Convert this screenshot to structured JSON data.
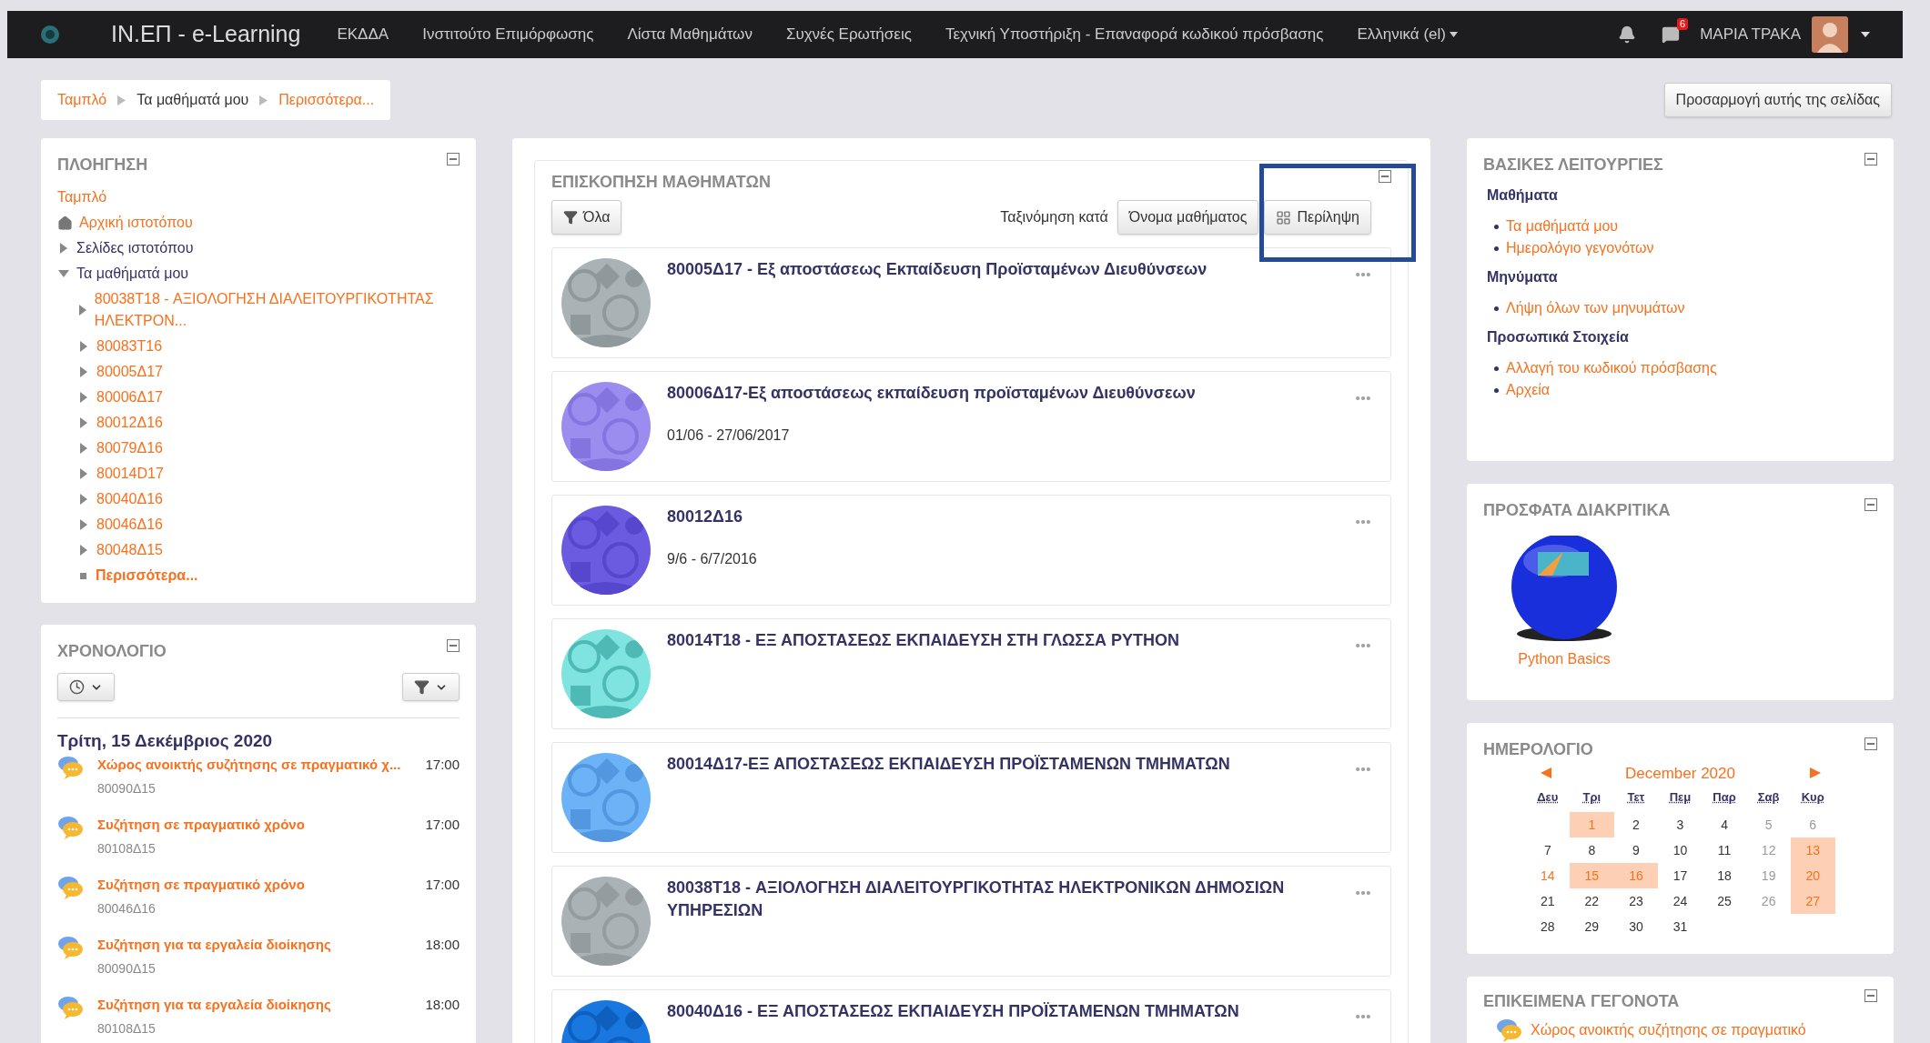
{
  "navbar": {
    "site_name": "ΙΝ.ΕΠ - e-Learning",
    "menu": [
      "ΕΚΔΔΑ",
      "Ινστιτούτο Επιμόρφωσης",
      "Λίστα Μαθημάτων",
      "Συχνές Ερωτήσεις",
      "Τεχνική Υποστήριξη - Επαναφορά κωδικού πρόσβασης"
    ],
    "language": "Ελληνικά (el)",
    "message_count": "6",
    "user_name": "ΜΑΡΙΑ ΤΡΑΚΑ"
  },
  "breadcrumb": [
    {
      "label": "Ταμπλό",
      "kind": "link"
    },
    {
      "label": "Τα μαθήματά μου",
      "kind": "current"
    },
    {
      "label": "Περισσότερα...",
      "kind": "link"
    }
  ],
  "customize_button": "Προσαρμογή αυτής της σελίδας",
  "navigation": {
    "title": "ΠΛΟΗΓΗΣΗ",
    "items": [
      {
        "kind": "link",
        "label": "Ταμπλό"
      },
      {
        "kind": "home",
        "label": "Αρχική ιστοτόπου"
      },
      {
        "kind": "branch",
        "label": "Σελίδες ιστοτόπου",
        "expanded": false
      },
      {
        "kind": "branch",
        "label": "Τα μαθήματά μου",
        "expanded": true,
        "children": [
          {
            "kind": "branch",
            "label": "80038T18 - ΑΞΙΟΛΟΓΗΣΗ ΔΙΑΛΕΙΤΟΥΡΓΙΚΟΤΗΤΑΣ ΗΛΕΚΤΡΟΝ...",
            "expanded": false
          },
          {
            "kind": "branch",
            "label": "80083T16",
            "expanded": false
          },
          {
            "kind": "branch",
            "label": "80005Δ17",
            "expanded": false
          },
          {
            "kind": "branch",
            "label": "80006Δ17",
            "expanded": false
          },
          {
            "kind": "branch",
            "label": "80012Δ16",
            "expanded": false
          },
          {
            "kind": "branch",
            "label": "80079Δ16",
            "expanded": false
          },
          {
            "kind": "branch",
            "label": "80014D17",
            "expanded": false
          },
          {
            "kind": "branch",
            "label": "80040Δ16",
            "expanded": false
          },
          {
            "kind": "branch",
            "label": "80046Δ16",
            "expanded": false
          },
          {
            "kind": "branch",
            "label": "80048Δ15",
            "expanded": false
          },
          {
            "kind": "more",
            "label": "Περισσότερα..."
          }
        ]
      }
    ]
  },
  "timeline": {
    "title": "ΧΡΟΝΟΛΟΓΙΟ",
    "date": "Τρίτη, 15 Δεκέμβριος 2020",
    "events": [
      {
        "title": "Χώρος ανοικτής συζήτησης σε πραγματικό χ...",
        "course": "80090Δ15",
        "time": "17:00"
      },
      {
        "title": "Συζήτηση σε πραγματικό χρόνο",
        "course": "80108Δ15",
        "time": "17:00"
      },
      {
        "title": "Συζήτηση σε πραγματικό χρόνο",
        "course": "80046Δ16",
        "time": "17:00"
      },
      {
        "title": "Συζήτηση για τα εργαλεία διοίκησης",
        "course": "80090Δ15",
        "time": "18:00"
      },
      {
        "title": "Συζήτηση για τα εργαλεία διοίκησης",
        "course": "80108Δ15",
        "time": "18:00"
      }
    ]
  },
  "course_overview": {
    "title": "ΕΠΙΣΚΟΠΗΣΗ ΜΑΘΗΜΑΤΩΝ",
    "filter_button": "Όλα",
    "sort_label": "Ταξινόμηση κατά",
    "sort_button": "Όνομα μαθήματος",
    "view_button": "Περίληψη",
    "courses": [
      {
        "title": "80005Δ17 - Εξ αποστάσεως Εκπαίδευση Προϊσταμένων Διευθύνσεων",
        "kind": "picture"
      },
      {
        "title": "80006Δ17-Εξ αποστάσεως εκπαίδευση προϊσταμένων Διευθύνσεων",
        "dates": "01/06 - 27/06/2017",
        "kind": "picture"
      },
      {
        "title": "80012Δ16",
        "dates": "9/6 - 6/7/2016",
        "kind": "picture"
      },
      {
        "title": "80014T18 - ΕΞ ΑΠΟΣΤΑΣΕΩΣ ΕΚΠΑΙΔΕΥΣΗ ΣΤΗ ΓΛΩΣΣΑ PYTHON",
        "kind": "picture"
      },
      {
        "title": "80014Δ17-ΕΞ ΑΠΟΣΤΑΣΕΩΣ ΕΚΠΑΙΔΕΥΣΗ ΠΡΟΪΣΤΑΜΕΝΩΝ ΤΜΗΜΑΤΩΝ",
        "kind": "picture"
      },
      {
        "title": "80038T18 - ΑΞΙΟΛΟΓΗΣΗ ΔΙΑΛΕΙΤΟΥΡΓΙΚΟΤΗΤΑΣ ΗΛΕΚΤΡΟΝΙΚΩΝ ΔΗΜΟΣΙΩΝ ΥΠΗΡΕΣΙΩΝ",
        "kind": "picture"
      },
      {
        "title": "80040Δ16 - ΕΞ ΑΠΟΣΤΑΣΕΩΣ ΕΚΠΑΙΔΕΥΣΗ ΠΡΟΪΣΤΑΜΕΝΩΝ ΤΜΗΜΑΤΩΝ",
        "kind": "picture"
      }
    ]
  },
  "basic_functions": {
    "title": "ΒΑΣΙΚΕΣ ΛΕΙΤΟΥΡΓΙΕΣ",
    "sections": [
      {
        "heading": "Μαθήματα",
        "links": [
          "Τα μαθήματά μου",
          "Ημερολόγιο γεγονότων"
        ]
      },
      {
        "heading": "Μηνύματα",
        "links": [
          "Λήψη όλων των μηνυμάτων"
        ]
      },
      {
        "heading": "Προσωπικά Στοιχεία",
        "links": [
          "Αλλαγή του κωδικού πρόσβασης",
          "Αρχεία"
        ]
      }
    ]
  },
  "recent_badges": {
    "title": "ΠΡΟΣΦΑΤΑ ΔΙΑΚΡΙΤΙΚΑ",
    "badges": [
      {
        "name": "Python Basics"
      }
    ]
  },
  "calendar": {
    "title": "ΗΜΕΡΟΛΟΓΙΟ",
    "month": "December 2020",
    "weekdays": [
      "Δευ",
      "Τρι",
      "Τετ",
      "Πεμ",
      "Παρ",
      "Σαβ",
      "Κυρ"
    ],
    "weeks": [
      [
        {
          "kind": "blank"
        },
        {
          "day": "1",
          "kind": "event"
        },
        {
          "day": "2",
          "kind": "plain"
        },
        {
          "day": "3",
          "kind": "plain"
        },
        {
          "day": "4",
          "kind": "plain"
        },
        {
          "day": "5",
          "kind": "weekend"
        },
        {
          "day": "6",
          "kind": "weekend"
        }
      ],
      [
        {
          "day": "7",
          "kind": "plain"
        },
        {
          "day": "8",
          "kind": "plain"
        },
        {
          "day": "9",
          "kind": "plain"
        },
        {
          "day": "10",
          "kind": "plain"
        },
        {
          "day": "11",
          "kind": "plain"
        },
        {
          "day": "12",
          "kind": "weekend"
        },
        {
          "day": "13",
          "kind": "event"
        }
      ],
      [
        {
          "day": "14",
          "kind": "link"
        },
        {
          "day": "15",
          "kind": "event"
        },
        {
          "day": "16",
          "kind": "event"
        },
        {
          "day": "17",
          "kind": "plain"
        },
        {
          "day": "18",
          "kind": "plain"
        },
        {
          "day": "19",
          "kind": "weekend"
        },
        {
          "day": "20",
          "kind": "event"
        }
      ],
      [
        {
          "day": "21",
          "kind": "plain"
        },
        {
          "day": "22",
          "kind": "plain"
        },
        {
          "day": "23",
          "kind": "plain"
        },
        {
          "day": "24",
          "kind": "plain"
        },
        {
          "day": "25",
          "kind": "plain"
        },
        {
          "day": "26",
          "kind": "weekend"
        },
        {
          "day": "27",
          "kind": "event"
        }
      ],
      [
        {
          "day": "28",
          "kind": "plain"
        },
        {
          "day": "29",
          "kind": "plain"
        },
        {
          "day": "30",
          "kind": "plain"
        },
        {
          "day": "31",
          "kind": "plain"
        },
        {
          "kind": "blank"
        },
        {
          "kind": "blank"
        },
        {
          "kind": "blank"
        }
      ]
    ]
  },
  "upcoming_events": {
    "title": "ΕΠΙΚΕΙΜΕΝΑ ΓΕΓΟΝΟΤΑ",
    "events": [
      "Χώρος ανοικτής συζήτησης σε πραγματικό"
    ]
  }
}
